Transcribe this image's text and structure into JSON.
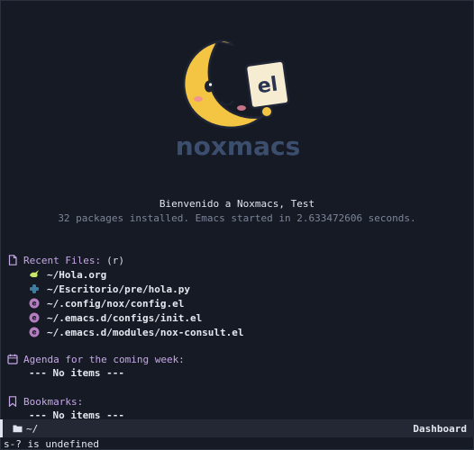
{
  "logo": {
    "label": "el",
    "wordmark": "noxmacs"
  },
  "banner": {
    "welcome": "Bienvenido a Noxmacs, Test",
    "stats": "32 packages installed. Emacs started in 2.633472606 seconds."
  },
  "recent_files": {
    "heading": "Recent Files:",
    "key": "(r)",
    "icon": "file-icon",
    "items": [
      {
        "path": "~/Hola.org",
        "icon": "org-unicorn-icon",
        "color": "#c8e86b"
      },
      {
        "path": "~/Escritorio/pre/hola.py",
        "icon": "python-icon",
        "color": "#3f7c9e"
      },
      {
        "path": "~/.config/nox/config.el",
        "icon": "elisp-icon",
        "color": "#b57cc0"
      },
      {
        "path": "~/.emacs.d/configs/init.el",
        "icon": "elisp-icon",
        "color": "#b57cc0"
      },
      {
        "path": "~/.emacs.d/modules/nox-consult.el",
        "icon": "elisp-icon",
        "color": "#b57cc0"
      }
    ]
  },
  "agenda": {
    "heading": "Agenda for the coming week:",
    "icon": "calendar-icon",
    "empty": "--- No items ---"
  },
  "bookmarks": {
    "heading": "Bookmarks:",
    "icon": "bookmark-icon",
    "empty": "--- No items ---"
  },
  "modeline": {
    "path": "~/",
    "mode": "Dashboard"
  },
  "echo_area": "s-? is undefined",
  "colors": {
    "background": "#161a24",
    "heading": "#c6a8e8",
    "muted": "#7c8598",
    "modeline_bg": "#232834"
  }
}
